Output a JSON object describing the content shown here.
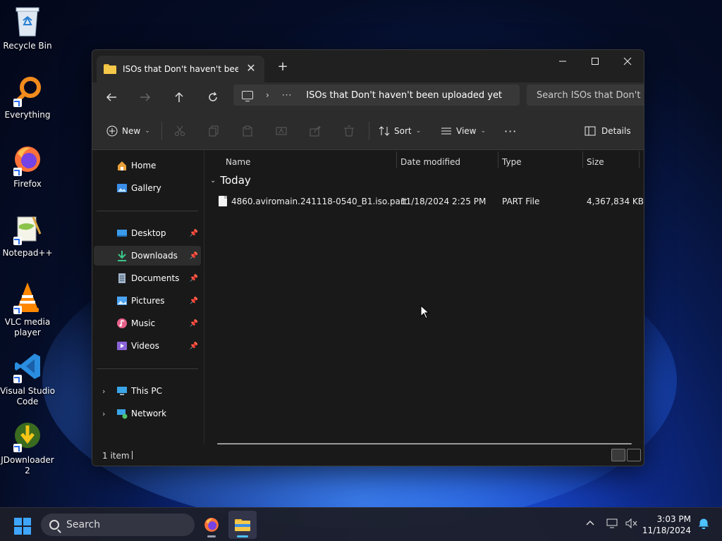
{
  "desktop": {
    "icons": [
      {
        "label": "Recycle Bin"
      },
      {
        "label": "Everything"
      },
      {
        "label": "Firefox"
      },
      {
        "label": "Notepad++"
      },
      {
        "label": "VLC media player"
      },
      {
        "label": "Visual Studio Code"
      },
      {
        "label": "JDownloader 2"
      }
    ]
  },
  "window": {
    "tab_title": "ISOs that Don't haven't been uploaded yet",
    "tab_close": "✕",
    "new_tab": "+",
    "address": {
      "separator": "›",
      "overflow": "···",
      "path": "ISOs that Don't haven't been uploaded yet"
    },
    "search_placeholder": "Search ISOs that Don't haven't been uploaded yet",
    "toolbar": {
      "new_label": "New",
      "sort_label": "Sort",
      "view_label": "View",
      "more_label": "···",
      "details_label": "Details"
    },
    "sidebar": {
      "home": "Home",
      "gallery": "Gallery",
      "desktop": "Desktop",
      "downloads": "Downloads",
      "documents": "Documents",
      "pictures": "Pictures",
      "music": "Music",
      "videos": "Videos",
      "this_pc": "This PC",
      "network": "Network"
    },
    "columns": {
      "name": "Name",
      "date_modified": "Date modified",
      "type": "Type",
      "size": "Size"
    },
    "group_label": "Today",
    "files": [
      {
        "name": "4860.aviromain.241118-0540_B1.iso.part",
        "date_modified": "11/18/2024 2:25 PM",
        "type": "PART File",
        "size": "4,367,834 KB"
      }
    ],
    "status": {
      "item_count": "1 item"
    }
  },
  "taskbar": {
    "search_label": "Search",
    "time": "3:03 PM",
    "date": "11/18/2024"
  },
  "colors": {
    "accent": "#4cc2ff",
    "window_bg": "#191919",
    "toolbar_bg": "#2c2c2c",
    "folder_yellow": "#f5c84a"
  }
}
